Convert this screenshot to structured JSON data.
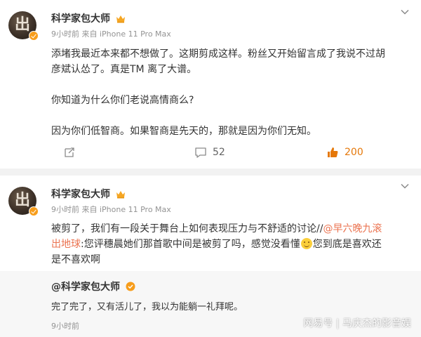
{
  "post1": {
    "author": "科学家包大师",
    "meta": "9小时前  来自 iPhone 11 Pro Max",
    "paragraphs": [
      "添堵我最近本来都不想做了。这期剪成这样。粉丝又开始留言成了我说不过胡彦斌认怂了。真是TM 离了大谱。",
      "你知道为什么你们老说高情商么?",
      "因为你们低智商。如果智商是先天的，那就是因为你们无知。"
    ],
    "comments": "52",
    "likes": "200"
  },
  "post2": {
    "author": "科学家包大师",
    "meta": "9小时前  来自 iPhone 11 Pro Max",
    "text_before_link": "被剪了，我们有一段关于舞台上如何表现压力与不舒适的讨论//",
    "link": "@早六晚九滚出地球",
    "text_after_link": ":您评穗晨她们那首歌中间是被剪了吗，感觉没看懂",
    "text_after_emoji": "您到底是喜欢还是不喜欢啊",
    "emoji_icon": "grin-emoji-icon",
    "quote": {
      "author": "@科学家包大师",
      "text": "完了完了，又有活儿了，我以为能躺一礼拜呢。",
      "time": "9小时前"
    }
  },
  "watermark": "网易号 | 马庆杰的影音娱",
  "colors": {
    "link": "#eb7350",
    "like": "#e5780a",
    "verified_badge": "#f79d1b",
    "meta": "#939393"
  }
}
